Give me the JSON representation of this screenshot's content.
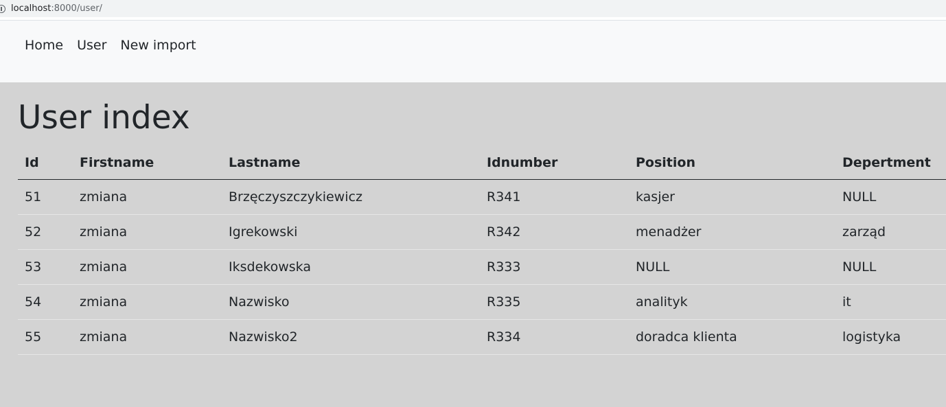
{
  "browser": {
    "url_host": "localhost",
    "url_path": ":8000/user/"
  },
  "nav": {
    "links": [
      {
        "label": "Home"
      },
      {
        "label": "User"
      },
      {
        "label": "New import"
      }
    ]
  },
  "page": {
    "title": "User index"
  },
  "table": {
    "headers": [
      "Id",
      "Firstname",
      "Lastname",
      "Idnumber",
      "Position",
      "Depertment"
    ],
    "rows": [
      [
        "51",
        "zmiana",
        "Brzęczyszczykiewicz",
        "R341",
        "kasjer",
        "NULL"
      ],
      [
        "52",
        "zmiana",
        "Igrekowski",
        "R342",
        "menadżer",
        "zarząd"
      ],
      [
        "53",
        "zmiana",
        "Iksdekowska",
        "R333",
        "NULL",
        "NULL"
      ],
      [
        "54",
        "zmiana",
        "Nazwisko",
        "R335",
        "analityk",
        "it"
      ],
      [
        "55",
        "zmiana",
        "Nazwisko2",
        "R334",
        "doradca klienta",
        "logistyka"
      ]
    ]
  },
  "colors": {
    "navbar_bg": "#f8f9fa",
    "body_bg": "#d3d3d3",
    "text": "#212529"
  }
}
